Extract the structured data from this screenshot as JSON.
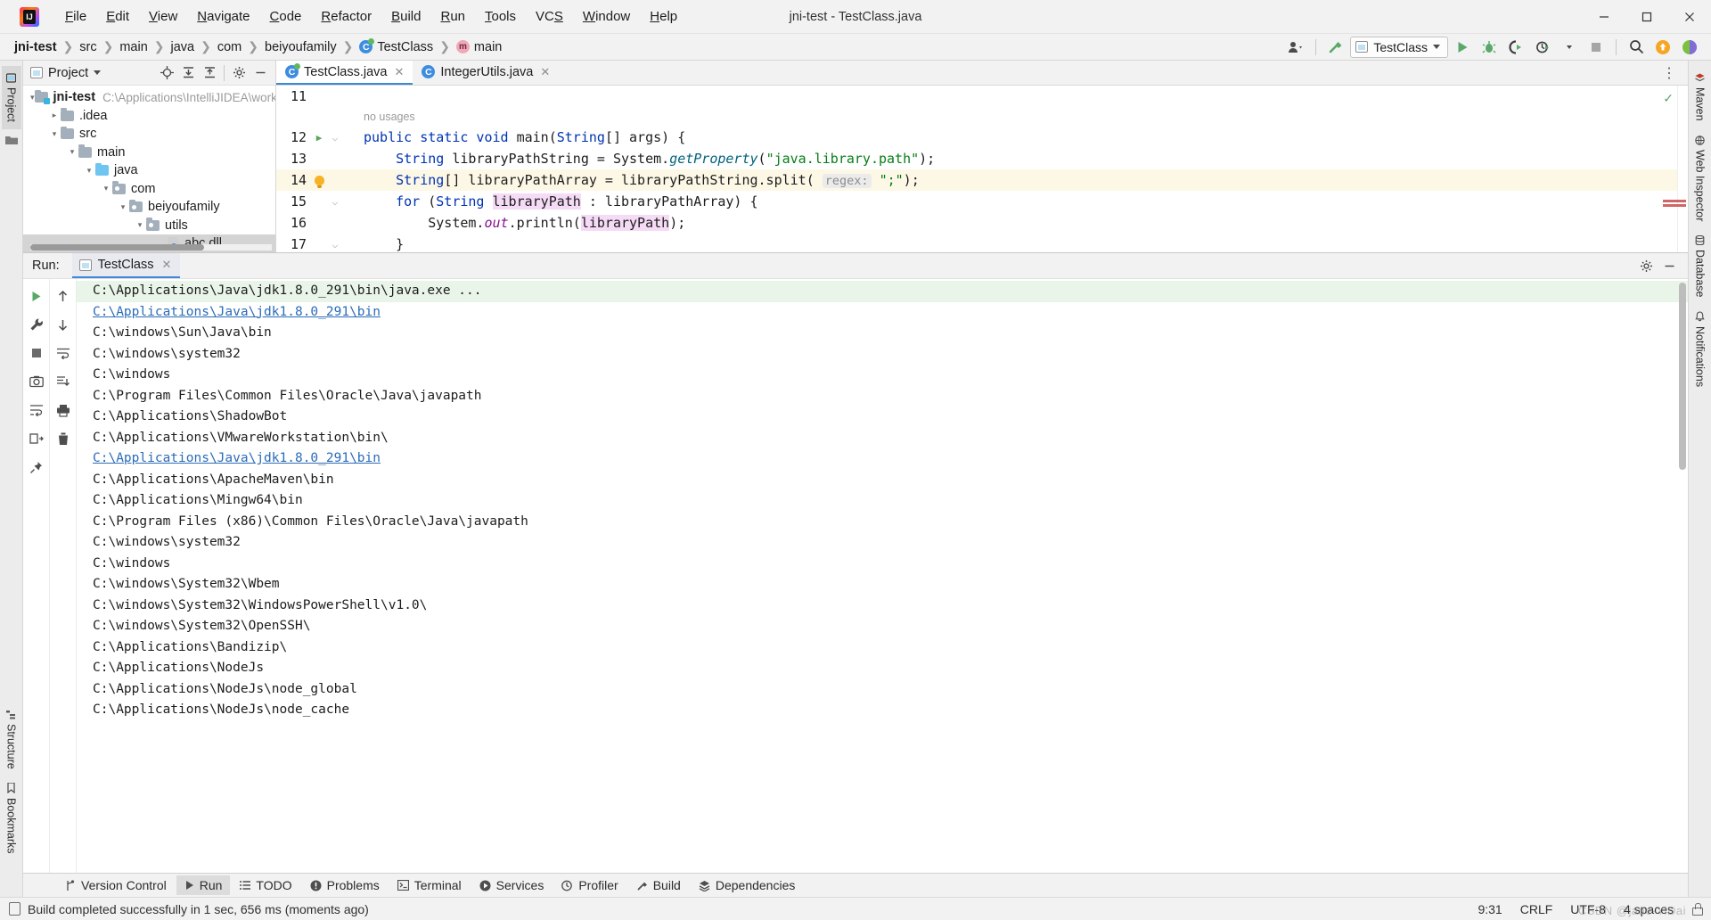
{
  "window": {
    "title": "jni-test - TestClass.java",
    "minimize_label": "–",
    "maximize_label": "☐",
    "close_label": "✕"
  },
  "menu": {
    "items": [
      {
        "label": "File",
        "mnemonic": "F"
      },
      {
        "label": "Edit",
        "mnemonic": "E"
      },
      {
        "label": "View",
        "mnemonic": "V"
      },
      {
        "label": "Navigate",
        "mnemonic": "N"
      },
      {
        "label": "Code",
        "mnemonic": "C"
      },
      {
        "label": "Refactor",
        "mnemonic": "R"
      },
      {
        "label": "Build",
        "mnemonic": "B"
      },
      {
        "label": "Run",
        "mnemonic": "R"
      },
      {
        "label": "Tools",
        "mnemonic": "T"
      },
      {
        "label": "VCS",
        "mnemonic": "S"
      },
      {
        "label": "Window",
        "mnemonic": "W"
      },
      {
        "label": "Help",
        "mnemonic": "H"
      }
    ]
  },
  "breadcrumb": {
    "items": [
      "jni-test",
      "src",
      "main",
      "java",
      "com",
      "beiyoufamily",
      "TestClass",
      "main"
    ],
    "separator": "❯"
  },
  "toolbar": {
    "run_config_name": "TestClass",
    "icons": [
      "user-account-icon",
      "build-hammer-icon",
      "run-icon",
      "debug-icon",
      "run-with-coverage-icon",
      "profile-icon",
      "stop-icon",
      "search-everywhere-icon",
      "update-project-icon",
      "ide-assistant-icon"
    ]
  },
  "left_strip": {
    "tabs": [
      {
        "label": "Project",
        "active": true
      },
      {
        "label": "Bookmarks",
        "active": false
      },
      {
        "label": "Structure",
        "active": false
      }
    ]
  },
  "right_strip": {
    "tabs": [
      {
        "label": "Maven"
      },
      {
        "label": "Web Inspector"
      },
      {
        "label": "Database"
      },
      {
        "label": "Notifications"
      }
    ]
  },
  "project_pane": {
    "title": "Project",
    "header_icons": [
      "locate-icon",
      "expand-all-icon",
      "collapse-all-icon",
      "settings-gear-icon",
      "hide-icon"
    ],
    "tree": [
      {
        "label": "jni-test",
        "path": "C:\\Applications\\IntelliJIDEA\\works",
        "depth": 0,
        "arrow": "⌄",
        "icon": "module-folder",
        "bold": true,
        "selected": false
      },
      {
        "label": ".idea",
        "path": "",
        "depth": 1,
        "arrow": "›",
        "icon": "folder",
        "bold": false,
        "selected": false
      },
      {
        "label": "src",
        "path": "",
        "depth": 1,
        "arrow": "⌄",
        "icon": "folder",
        "bold": false,
        "selected": false
      },
      {
        "label": "main",
        "path": "",
        "depth": 2,
        "arrow": "⌄",
        "icon": "folder",
        "bold": false,
        "selected": false
      },
      {
        "label": "java",
        "path": "",
        "depth": 3,
        "arrow": "⌄",
        "icon": "source-folder",
        "bold": false,
        "selected": false
      },
      {
        "label": "com",
        "path": "",
        "depth": 4,
        "arrow": "⌄",
        "icon": "package-folder",
        "bold": false,
        "selected": false
      },
      {
        "label": "beiyoufamily",
        "path": "",
        "depth": 5,
        "arrow": "⌄",
        "icon": "package-folder",
        "bold": false,
        "selected": false
      },
      {
        "label": "utils",
        "path": "",
        "depth": 6,
        "arrow": "⌄",
        "icon": "package-folder",
        "bold": false,
        "selected": false
      },
      {
        "label": "abc.dll",
        "path": "",
        "depth": 7,
        "arrow": "",
        "icon": "unknown-file",
        "bold": false,
        "selected": true
      }
    ]
  },
  "editor": {
    "tabs": [
      {
        "label": "TestClass.java",
        "active": true,
        "modified": true,
        "close_label": "✕"
      },
      {
        "label": "IntegerUtils.java",
        "active": false,
        "modified": false,
        "close_label": "✕"
      }
    ],
    "inlay_hint": "no usages",
    "lines": [
      {
        "num": "11",
        "text": "",
        "highlight": false
      },
      {
        "num": "12",
        "text": "public static void main(String[] args) {",
        "highlight": false,
        "gutter": "run-icon",
        "fold": true
      },
      {
        "num": "13",
        "text": "    String libraryPathString = System.getProperty(\"java.library.path\");",
        "highlight": false
      },
      {
        "num": "14",
        "text": "    String[] libraryPathArray = libraryPathString.split( regex: \";\");",
        "highlight": true,
        "gutter": "intention-bulb"
      },
      {
        "num": "15",
        "text": "    for (String libraryPath : libraryPathArray) {",
        "highlight": false,
        "fold": true
      },
      {
        "num": "16",
        "text": "        System.out.println(libraryPath);",
        "highlight": false
      },
      {
        "num": "17",
        "text": "    }",
        "highlight": false,
        "fold": true
      }
    ],
    "param_hint": "regex:",
    "inspection_status": "ok"
  },
  "run_window": {
    "label": "Run:",
    "tab_name": "TestClass",
    "tab_close_label": "✕",
    "left_icons": [
      "rerun-icon",
      "settings-wrench-icon",
      "stop-icon",
      "screenshot-icon",
      "soft-wrap-icon",
      "export-icon"
    ],
    "left_icons_2": [
      "scroll-up-icon",
      "scroll-down-icon",
      "soft-wrap-icon",
      "scroll-to-end-icon",
      "print-icon",
      "clear-all-icon"
    ],
    "header_icons": [
      "settings-gear-icon",
      "hide-icon"
    ],
    "console": [
      {
        "text": "C:\\Applications\\Java\\jdk1.8.0_291\\bin\\java.exe ...",
        "style": "command"
      },
      {
        "text": "C:\\Applications\\Java\\jdk1.8.0_291\\bin",
        "style": "link"
      },
      {
        "text": "C:\\windows\\Sun\\Java\\bin",
        "style": "plain"
      },
      {
        "text": "C:\\windows\\system32",
        "style": "plain"
      },
      {
        "text": "C:\\windows",
        "style": "plain"
      },
      {
        "text": "C:\\Program Files\\Common Files\\Oracle\\Java\\javapath",
        "style": "plain"
      },
      {
        "text": "C:\\Applications\\ShadowBot",
        "style": "plain"
      },
      {
        "text": "C:\\Applications\\VMwareWorkstation\\bin\\",
        "style": "plain"
      },
      {
        "text": "C:\\Applications\\Java\\jdk1.8.0_291\\bin",
        "style": "link-cursor"
      },
      {
        "text": "C:\\Applications\\ApacheMaven\\bin",
        "style": "plain"
      },
      {
        "text": "C:\\Applications\\Mingw64\\bin",
        "style": "plain"
      },
      {
        "text": "C:\\Program Files (x86)\\Common Files\\Oracle\\Java\\javapath",
        "style": "plain"
      },
      {
        "text": "C:\\windows\\system32",
        "style": "plain"
      },
      {
        "text": "C:\\windows",
        "style": "plain"
      },
      {
        "text": "C:\\windows\\System32\\Wbem",
        "style": "plain"
      },
      {
        "text": "C:\\windows\\System32\\WindowsPowerShell\\v1.0\\",
        "style": "plain"
      },
      {
        "text": "C:\\windows\\System32\\OpenSSH\\",
        "style": "plain"
      },
      {
        "text": "C:\\Applications\\Bandizip\\",
        "style": "plain"
      },
      {
        "text": "C:\\Applications\\NodeJs",
        "style": "plain"
      },
      {
        "text": "C:\\Applications\\NodeJs\\node_global",
        "style": "plain"
      },
      {
        "text": "C:\\Applications\\NodeJs\\node_cache",
        "style": "plain"
      }
    ]
  },
  "bottom_tabs": [
    {
      "label": "Version Control",
      "icon": "branch-icon",
      "active": false
    },
    {
      "label": "Run",
      "icon": "run-icon",
      "active": true
    },
    {
      "label": "TODO",
      "icon": "list-icon",
      "active": false
    },
    {
      "label": "Problems",
      "icon": "error-icon",
      "active": false
    },
    {
      "label": "Terminal",
      "icon": "terminal-icon",
      "active": false
    },
    {
      "label": "Services",
      "icon": "services-icon",
      "active": false
    },
    {
      "label": "Profiler",
      "icon": "profiler-icon",
      "active": false
    },
    {
      "label": "Build",
      "icon": "hammer-icon",
      "active": false
    },
    {
      "label": "Dependencies",
      "icon": "layers-icon",
      "active": false
    }
  ],
  "status_bar": {
    "message": "Build completed successfully in 1 sec, 656 ms (moments ago)",
    "caret_position": "9:31",
    "line_separator": "CRLF",
    "encoding": "UTF-8",
    "indent": "4 spaces",
    "watermark": "CSDN @jane-YiDai"
  },
  "colors": {
    "accent": "#3c87d6",
    "run_green": "#59a869",
    "keyword": "#0033b3",
    "string": "#067d17",
    "link": "#2b6cb8",
    "highlight_line": "#fdf8e6",
    "console_cmd_bg": "#e9f5e9"
  }
}
